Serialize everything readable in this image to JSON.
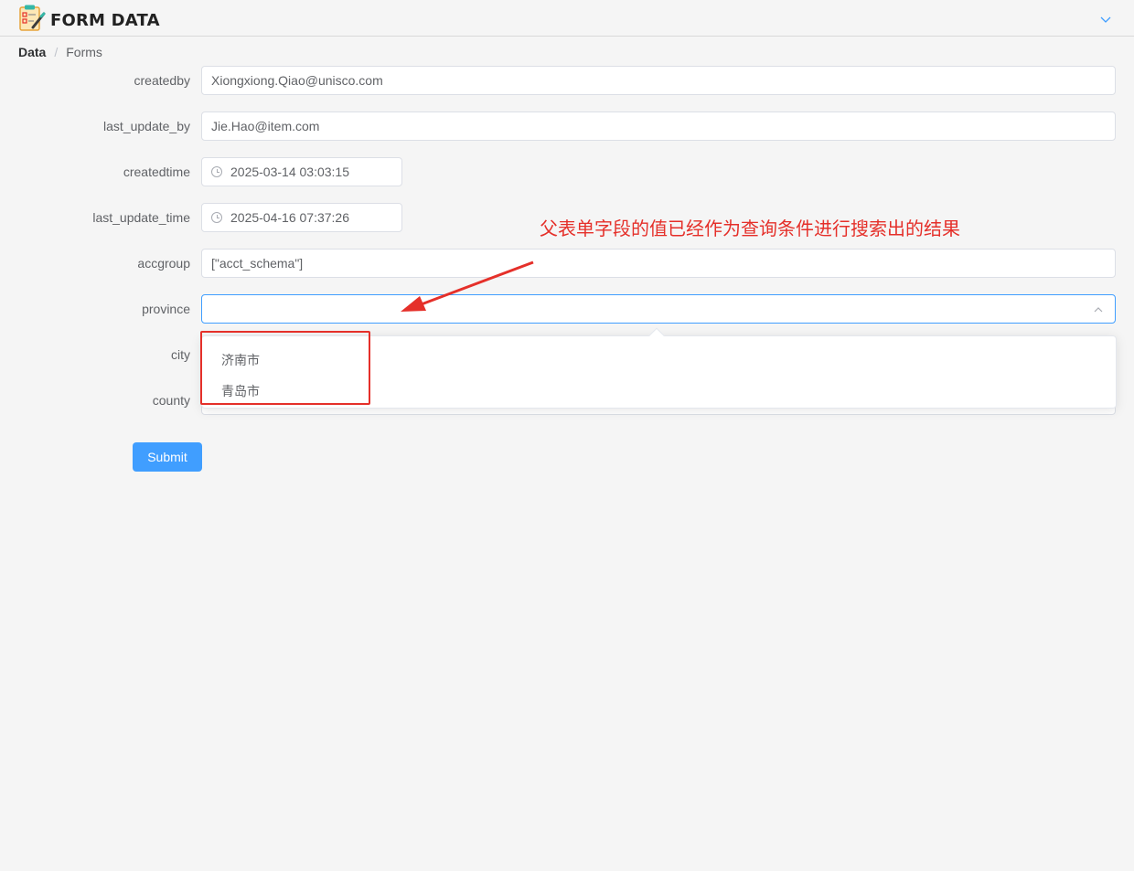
{
  "header": {
    "title": "FORM DATA",
    "logo_icon": "clipboard-checklist-icon",
    "collapse_icon": "chevron-down-icon",
    "accent_color": "#409eff"
  },
  "breadcrumb": {
    "items": [
      "Data",
      "Forms"
    ],
    "separator": "/"
  },
  "form": {
    "fields": [
      {
        "label": "createdby",
        "value": "Xiongxiong.Qiao@unisco.com"
      },
      {
        "label": "last_update_by",
        "value": "Jie.Hao@item.com"
      },
      {
        "label": "createdtime",
        "value": "2025-03-14 03:03:15"
      },
      {
        "label": "last_update_time",
        "value": "2025-04-16 07:37:26"
      },
      {
        "label": "accgroup",
        "value": "[\"acct_schema\"]"
      },
      {
        "label": "province",
        "value": ""
      },
      {
        "label": "city",
        "value": ""
      },
      {
        "label": "county",
        "value": ""
      }
    ],
    "submit_label": "Submit"
  },
  "dropdown": {
    "options": [
      "济南市",
      "青岛市"
    ]
  },
  "annotation": {
    "text": "父表单字段的值已经作为查询条件进行搜索出的结果",
    "color": "#e5302a"
  }
}
